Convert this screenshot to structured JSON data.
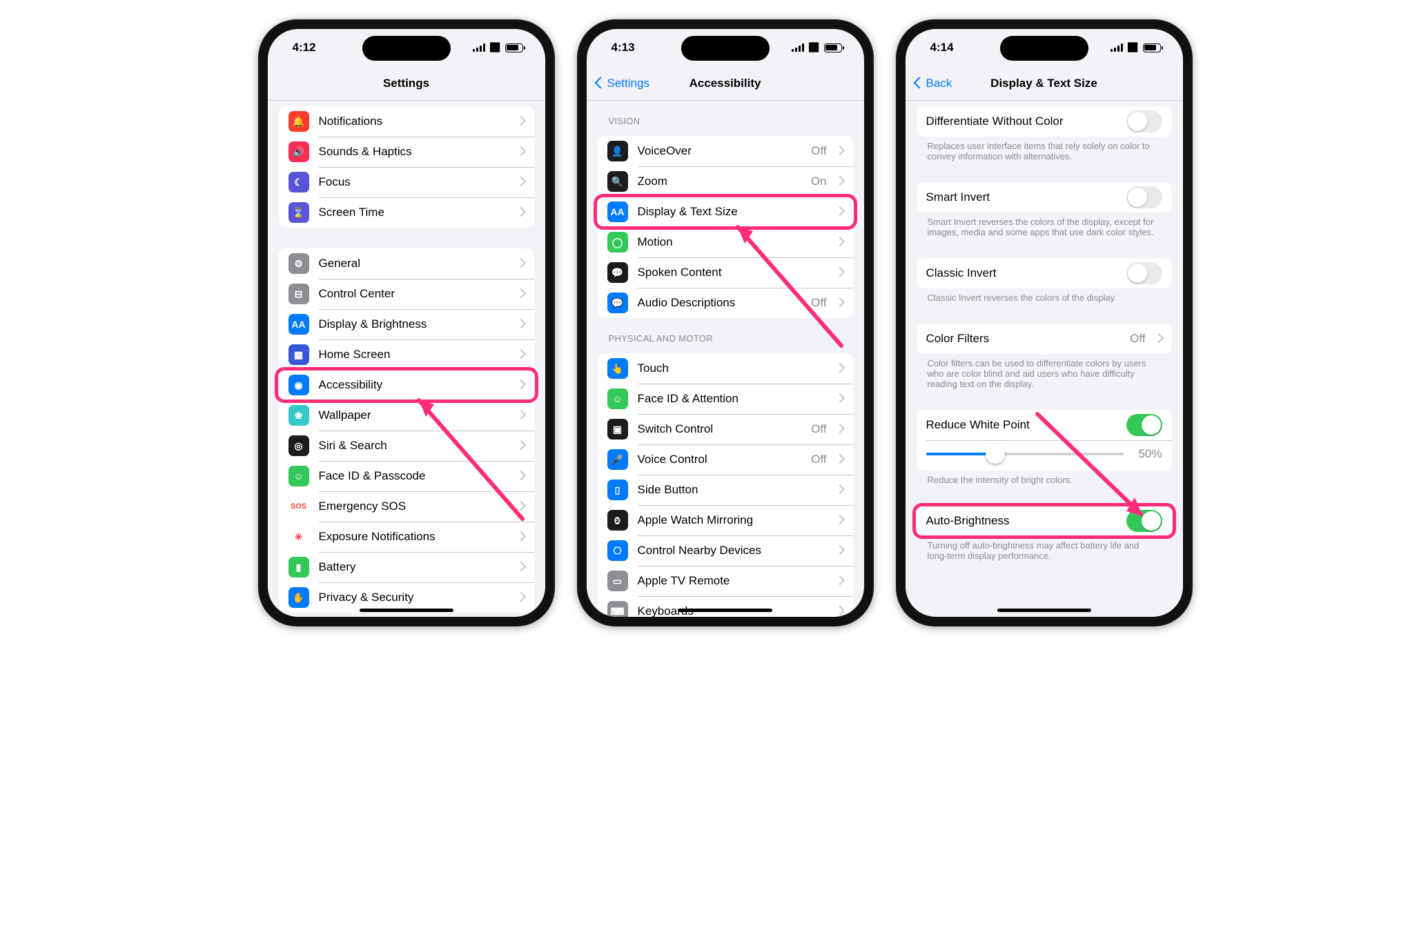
{
  "phones": [
    {
      "time": "4:12",
      "title": "Settings",
      "back": null,
      "groups": [
        {
          "header": null,
          "rows": [
            {
              "icon": "notifications-icon",
              "iconColor": "#ff3b30",
              "iconGlyph": "🔔",
              "label": "Notifications",
              "chev": true
            },
            {
              "icon": "sounds-icon",
              "iconColor": "#ff2d55",
              "iconGlyph": "🔊",
              "label": "Sounds & Haptics",
              "chev": true
            },
            {
              "icon": "focus-icon",
              "iconColor": "#5856d6",
              "iconGlyph": "☾",
              "label": "Focus",
              "chev": true
            },
            {
              "icon": "screentime-icon",
              "iconColor": "#5856d6",
              "iconGlyph": "⌛",
              "label": "Screen Time",
              "chev": true
            }
          ]
        },
        {
          "header": null,
          "rows": [
            {
              "icon": "general-icon",
              "iconColor": "#8e8e93",
              "iconGlyph": "⚙︎",
              "label": "General",
              "chev": true
            },
            {
              "icon": "control-center-icon",
              "iconColor": "#8e8e93",
              "iconGlyph": "⊟",
              "label": "Control Center",
              "chev": true
            },
            {
              "icon": "display-brightness-icon",
              "iconColor": "#007aff",
              "iconGlyph": "AA",
              "label": "Display & Brightness",
              "chev": true
            },
            {
              "icon": "home-screen-icon",
              "iconColor": "#3955d9",
              "iconGlyph": "▦",
              "label": "Home Screen",
              "chev": true
            },
            {
              "icon": "accessibility-icon",
              "iconColor": "#007aff",
              "iconGlyph": "◉",
              "label": "Accessibility",
              "chev": true,
              "highlight": true
            },
            {
              "icon": "wallpaper-icon",
              "iconColor": "#34c8c8",
              "iconGlyph": "❀",
              "label": "Wallpaper",
              "chev": true
            },
            {
              "icon": "siri-icon",
              "iconColor": "#1c1c1e",
              "iconGlyph": "◎",
              "label": "Siri & Search",
              "chev": true
            },
            {
              "icon": "faceid-icon",
              "iconColor": "#34c759",
              "iconGlyph": "☺︎",
              "label": "Face ID & Passcode",
              "chev": true
            },
            {
              "icon": "sos-icon",
              "iconColor": "#ffffff",
              "iconText": "SOS",
              "iconTextColor": "#ff3b30",
              "label": "Emergency SOS",
              "chev": true
            },
            {
              "icon": "exposure-icon",
              "iconColor": "#ffffff",
              "iconGlyph": "✳︎",
              "iconTextColor": "#ff3b30",
              "label": "Exposure Notifications",
              "chev": true
            },
            {
              "icon": "battery-icon",
              "iconColor": "#34c759",
              "iconGlyph": "▮",
              "label": "Battery",
              "chev": true
            },
            {
              "icon": "privacy-icon",
              "iconColor": "#007aff",
              "iconGlyph": "✋",
              "label": "Privacy & Security",
              "chev": true
            }
          ]
        }
      ]
    },
    {
      "time": "4:13",
      "title": "Accessibility",
      "back": "Settings",
      "groups": [
        {
          "header": "VISION",
          "rows": [
            {
              "icon": "voiceover-icon",
              "iconColor": "#1c1c1e",
              "iconGlyph": "👤",
              "label": "VoiceOver",
              "value": "Off",
              "chev": true
            },
            {
              "icon": "zoom-icon",
              "iconColor": "#1c1c1e",
              "iconGlyph": "🔍",
              "label": "Zoom",
              "value": "On",
              "chev": true
            },
            {
              "icon": "display-text-icon",
              "iconColor": "#007aff",
              "iconGlyph": "AA",
              "label": "Display & Text Size",
              "chev": true,
              "highlight": true
            },
            {
              "icon": "motion-icon",
              "iconColor": "#34c759",
              "iconGlyph": "◯",
              "label": "Motion",
              "chev": true
            },
            {
              "icon": "spoken-content-icon",
              "iconColor": "#1c1c1e",
              "iconGlyph": "💬",
              "label": "Spoken Content",
              "chev": true
            },
            {
              "icon": "audio-desc-icon",
              "iconColor": "#007aff",
              "iconGlyph": "💬",
              "label": "Audio Descriptions",
              "value": "Off",
              "chev": true
            }
          ]
        },
        {
          "header": "PHYSICAL AND MOTOR",
          "rows": [
            {
              "icon": "touch-icon",
              "iconColor": "#007aff",
              "iconGlyph": "👆",
              "label": "Touch",
              "chev": true
            },
            {
              "icon": "faceid-attn-icon",
              "iconColor": "#34c759",
              "iconGlyph": "☺︎",
              "label": "Face ID & Attention",
              "chev": true
            },
            {
              "icon": "switch-control-icon",
              "iconColor": "#1c1c1e",
              "iconGlyph": "▣",
              "label": "Switch Control",
              "value": "Off",
              "chev": true
            },
            {
              "icon": "voice-control-icon",
              "iconColor": "#007aff",
              "iconGlyph": "🎤",
              "label": "Voice Control",
              "value": "Off",
              "chev": true
            },
            {
              "icon": "side-button-icon",
              "iconColor": "#007aff",
              "iconGlyph": "▯",
              "label": "Side Button",
              "chev": true
            },
            {
              "icon": "watch-mirror-icon",
              "iconColor": "#1c1c1e",
              "iconGlyph": "⌚︎",
              "label": "Apple Watch Mirroring",
              "chev": true
            },
            {
              "icon": "nearby-devices-icon",
              "iconColor": "#007aff",
              "iconGlyph": "⎔",
              "label": "Control Nearby Devices",
              "chev": true
            },
            {
              "icon": "appletv-remote-icon",
              "iconColor": "#8e8e93",
              "iconGlyph": "▭",
              "label": "Apple TV Remote",
              "chev": true
            },
            {
              "icon": "keyboards-icon",
              "iconColor": "#8e8e93",
              "iconGlyph": "⌨︎",
              "label": "Keyboards",
              "chev": true
            }
          ]
        }
      ]
    },
    {
      "time": "4:14",
      "title": "Display & Text Size",
      "back": "Back",
      "groups": [
        {
          "rows": [
            {
              "label": "Differentiate Without Color",
              "toggle": false,
              "noIcon": true
            }
          ],
          "footer": "Replaces user interface items that rely solely on color to convey information with alternatives."
        },
        {
          "rows": [
            {
              "label": "Smart Invert",
              "toggle": false,
              "noIcon": true
            }
          ],
          "footer": "Smart Invert reverses the colors of the display, except for images, media and some apps that use dark color styles."
        },
        {
          "rows": [
            {
              "label": "Classic Invert",
              "toggle": false,
              "noIcon": true
            }
          ],
          "footer": "Classic Invert reverses the colors of the display."
        },
        {
          "rows": [
            {
              "label": "Color Filters",
              "value": "Off",
              "chev": true,
              "noIcon": true
            }
          ],
          "footer": "Color filters can be used to differentiate colors by users who are color blind and aid users who have difficulty reading text on the display."
        },
        {
          "rows": [
            {
              "label": "Reduce White Point",
              "toggle": true,
              "noIcon": true
            },
            {
              "slider": true,
              "sliderPct": 35,
              "sliderLabel": "50%",
              "noIcon": true
            }
          ],
          "footer": "Reduce the intensity of bright colors."
        },
        {
          "rows": [
            {
              "label": "Auto-Brightness",
              "toggle": true,
              "noIcon": true,
              "highlight": true
            }
          ],
          "footer": "Turning off auto-brightness may affect battery life and long-term display performance."
        }
      ]
    }
  ]
}
